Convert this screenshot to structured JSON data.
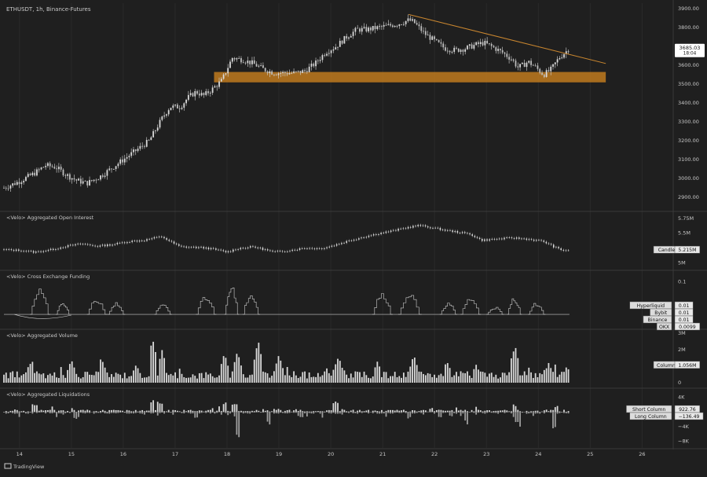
{
  "header": {
    "symbol_line": "ETHUSDT, 1h, Binance-Futures"
  },
  "footer": {
    "brand": "TradingView"
  },
  "colors": {
    "background": "#1f1f1f",
    "grid": "#2a2a2a",
    "separator": "#3a3a3a",
    "text": "#c8c8c8",
    "candle": "#d9d9d9",
    "support_zone": "#c07a1e",
    "trendline": "#c9862f",
    "price_badge_bg": "#ffffff",
    "price_badge_text": "#131313"
  },
  "chart_data": [
    {
      "type": "candlestick",
      "title": "ETHUSDT, 1h, Binance-Futures",
      "x_ticks": [
        "14",
        "15",
        "16",
        "17",
        "18",
        "19",
        "20",
        "21",
        "22",
        "23",
        "24",
        "25",
        "26"
      ],
      "x_range": [
        13.7,
        26.6
      ],
      "y_ticks": [
        "3900.00",
        "3800.00",
        "3700.00",
        "3600.00",
        "3500.00",
        "3400.00",
        "3300.00",
        "3200.00",
        "3100.00",
        "3000.00",
        "2900.00"
      ],
      "y_range": [
        2830,
        3930
      ],
      "last_price": "3685.03",
      "countdown": "18:04",
      "keypoints": [
        [
          13.7,
          2950
        ],
        [
          14.0,
          2985
        ],
        [
          14.3,
          3030
        ],
        [
          14.5,
          3070
        ],
        [
          14.7,
          3060
        ],
        [
          14.9,
          3020
        ],
        [
          15.1,
          2990
        ],
        [
          15.3,
          2975
        ],
        [
          15.55,
          3010
        ],
        [
          15.8,
          3060
        ],
        [
          16.0,
          3100
        ],
        [
          16.2,
          3140
        ],
        [
          16.5,
          3200
        ],
        [
          16.75,
          3320
        ],
        [
          16.9,
          3380
        ],
        [
          17.1,
          3380
        ],
        [
          17.25,
          3430
        ],
        [
          17.4,
          3460
        ],
        [
          17.55,
          3440
        ],
        [
          17.7,
          3470
        ],
        [
          17.9,
          3520
        ],
        [
          18.1,
          3640
        ],
        [
          18.3,
          3630
        ],
        [
          18.5,
          3610
        ],
        [
          18.7,
          3580
        ],
        [
          18.9,
          3560
        ],
        [
          19.1,
          3560
        ],
        [
          19.3,
          3560
        ],
        [
          19.5,
          3570
        ],
        [
          19.7,
          3610
        ],
        [
          19.9,
          3670
        ],
        [
          20.1,
          3700
        ],
        [
          20.3,
          3750
        ],
        [
          20.5,
          3790
        ],
        [
          20.7,
          3790
        ],
        [
          20.9,
          3800
        ],
        [
          21.1,
          3810
        ],
        [
          21.3,
          3820
        ],
        [
          21.5,
          3840
        ],
        [
          21.6,
          3830
        ],
        [
          21.8,
          3770
        ],
        [
          22.0,
          3730
        ],
        [
          22.2,
          3690
        ],
        [
          22.4,
          3680
        ],
        [
          22.6,
          3690
        ],
        [
          22.8,
          3710
        ],
        [
          22.95,
          3720
        ],
        [
          23.1,
          3700
        ],
        [
          23.3,
          3670
        ],
        [
          23.5,
          3630
        ],
        [
          23.6,
          3590
        ],
        [
          23.7,
          3600
        ],
        [
          23.8,
          3620
        ],
        [
          23.95,
          3590
        ],
        [
          24.1,
          3550
        ],
        [
          24.25,
          3580
        ],
        [
          24.4,
          3640
        ],
        [
          24.58,
          3685.03
        ]
      ],
      "annotations": [
        {
          "kind": "support_zone",
          "x_start": 17.75,
          "x_end": 25.3,
          "y_low": 3510,
          "y_high": 3565
        },
        {
          "kind": "trendline",
          "from": [
            21.5,
            3870
          ],
          "to": [
            25.3,
            3610
          ]
        }
      ]
    },
    {
      "type": "line",
      "title": "<Velo> Aggregated Open Interest",
      "y_ticks": [
        "5.75M",
        "5.5M",
        "5.25M",
        "5M"
      ],
      "y_range": [
        4.94,
        5.8
      ],
      "label": "Candles",
      "last_value": "5.215M",
      "keypoints": [
        [
          13.7,
          5.22
        ],
        [
          14.0,
          5.21
        ],
        [
          14.3,
          5.18
        ],
        [
          14.6,
          5.22
        ],
        [
          14.9,
          5.28
        ],
        [
          15.2,
          5.32
        ],
        [
          15.5,
          5.28
        ],
        [
          15.8,
          5.31
        ],
        [
          16.1,
          5.36
        ],
        [
          16.4,
          5.38
        ],
        [
          16.6,
          5.42
        ],
        [
          16.75,
          5.44
        ],
        [
          16.9,
          5.36
        ],
        [
          17.1,
          5.27
        ],
        [
          17.4,
          5.26
        ],
        [
          17.6,
          5.25
        ],
        [
          17.8,
          5.22
        ],
        [
          18.0,
          5.18
        ],
        [
          18.2,
          5.24
        ],
        [
          18.5,
          5.27
        ],
        [
          18.7,
          5.23
        ],
        [
          18.9,
          5.18
        ],
        [
          19.2,
          5.21
        ],
        [
          19.5,
          5.25
        ],
        [
          19.8,
          5.24
        ],
        [
          20.0,
          5.28
        ],
        [
          20.3,
          5.36
        ],
        [
          20.6,
          5.43
        ],
        [
          20.9,
          5.49
        ],
        [
          21.2,
          5.54
        ],
        [
          21.5,
          5.6
        ],
        [
          21.7,
          5.63
        ],
        [
          21.9,
          5.6
        ],
        [
          22.2,
          5.55
        ],
        [
          22.5,
          5.51
        ],
        [
          22.7,
          5.48
        ],
        [
          22.9,
          5.38
        ],
        [
          23.2,
          5.4
        ],
        [
          23.5,
          5.42
        ],
        [
          23.8,
          5.4
        ],
        [
          24.1,
          5.36
        ],
        [
          24.3,
          5.27
        ],
        [
          24.45,
          5.21
        ],
        [
          24.58,
          5.215
        ]
      ]
    },
    {
      "type": "step-line",
      "title": "<Velo> Cross Exchange Funding",
      "y_ticks": [
        "0.1"
      ],
      "y_range": [
        -0.02,
        0.12
      ],
      "base_value": 0.01,
      "bumps": [
        {
          "x": 14.2,
          "w": 0.35,
          "h": 0.07
        },
        {
          "x": 14.7,
          "w": 0.25,
          "h": 0.03
        },
        {
          "x": 15.3,
          "w": 0.35,
          "h": 0.04
        },
        {
          "x": 15.7,
          "w": 0.3,
          "h": 0.03
        },
        {
          "x": 16.6,
          "w": 0.3,
          "h": 0.025
        },
        {
          "x": 17.4,
          "w": 0.35,
          "h": 0.05
        },
        {
          "x": 17.95,
          "w": 0.25,
          "h": 0.085
        },
        {
          "x": 18.3,
          "w": 0.3,
          "h": 0.06
        },
        {
          "x": 20.8,
          "w": 0.35,
          "h": 0.06
        },
        {
          "x": 21.3,
          "w": 0.4,
          "h": 0.055
        },
        {
          "x": 22.1,
          "w": 0.3,
          "h": 0.03
        },
        {
          "x": 22.5,
          "w": 0.35,
          "h": 0.045
        },
        {
          "x": 23.0,
          "w": 0.3,
          "h": 0.02
        },
        {
          "x": 23.4,
          "w": 0.25,
          "h": 0.045
        },
        {
          "x": 23.8,
          "w": 0.3,
          "h": 0.03
        }
      ],
      "legend": [
        {
          "name": "Hyperliquid",
          "value": "0.01"
        },
        {
          "name": "Bybit",
          "value": "0.01"
        },
        {
          "name": "Binance",
          "value": "0.01"
        },
        {
          "name": "OKX",
          "value": "0.0099"
        }
      ]
    },
    {
      "type": "bar",
      "title": "<Velo> Aggregated Volume",
      "y_ticks": [
        "3M",
        "2M",
        "1M",
        "0"
      ],
      "y_range": [
        0,
        3000000
      ],
      "label": "Column",
      "last_value": "1.056M",
      "spikes": [
        [
          14.2,
          1.2
        ],
        [
          15.0,
          1.4
        ],
        [
          15.6,
          1.3
        ],
        [
          16.25,
          1.1
        ],
        [
          16.58,
          2.5
        ],
        [
          16.75,
          2.0
        ],
        [
          17.95,
          1.8
        ],
        [
          18.2,
          1.9
        ],
        [
          18.6,
          2.6
        ],
        [
          19.0,
          1.7
        ],
        [
          20.15,
          1.6
        ],
        [
          20.9,
          1.3
        ],
        [
          21.6,
          1.7
        ],
        [
          22.25,
          1.2
        ],
        [
          22.8,
          1.1
        ],
        [
          23.55,
          2.3
        ],
        [
          24.2,
          1.2
        ],
        [
          24.55,
          1.0
        ]
      ]
    },
    {
      "type": "bar",
      "title": "<Velo> Aggregated Liquidations",
      "y_ticks": [
        "4K",
        "0",
        "−4K",
        "−8K"
      ],
      "y_range": [
        -9000,
        5000
      ],
      "series": [
        {
          "name": "Short Column",
          "last_value": "922.76"
        },
        {
          "name": "Long Column",
          "last_value": "−136.49"
        }
      ],
      "short_spikes": [
        [
          14.3,
          2200
        ],
        [
          16.55,
          3800
        ],
        [
          16.7,
          2800
        ],
        [
          17.95,
          2600
        ],
        [
          18.15,
          2200
        ],
        [
          20.1,
          3500
        ],
        [
          23.55,
          2200
        ],
        [
          24.35,
          1800
        ]
      ],
      "long_spikes": [
        [
          15.1,
          -2200
        ],
        [
          17.4,
          -1800
        ],
        [
          18.2,
          -8000
        ],
        [
          18.8,
          -3800
        ],
        [
          19.4,
          -1600
        ],
        [
          21.5,
          -2200
        ],
        [
          22.1,
          -1800
        ],
        [
          22.6,
          -3300
        ],
        [
          23.6,
          -4200
        ],
        [
          24.3,
          -4500
        ]
      ]
    }
  ]
}
